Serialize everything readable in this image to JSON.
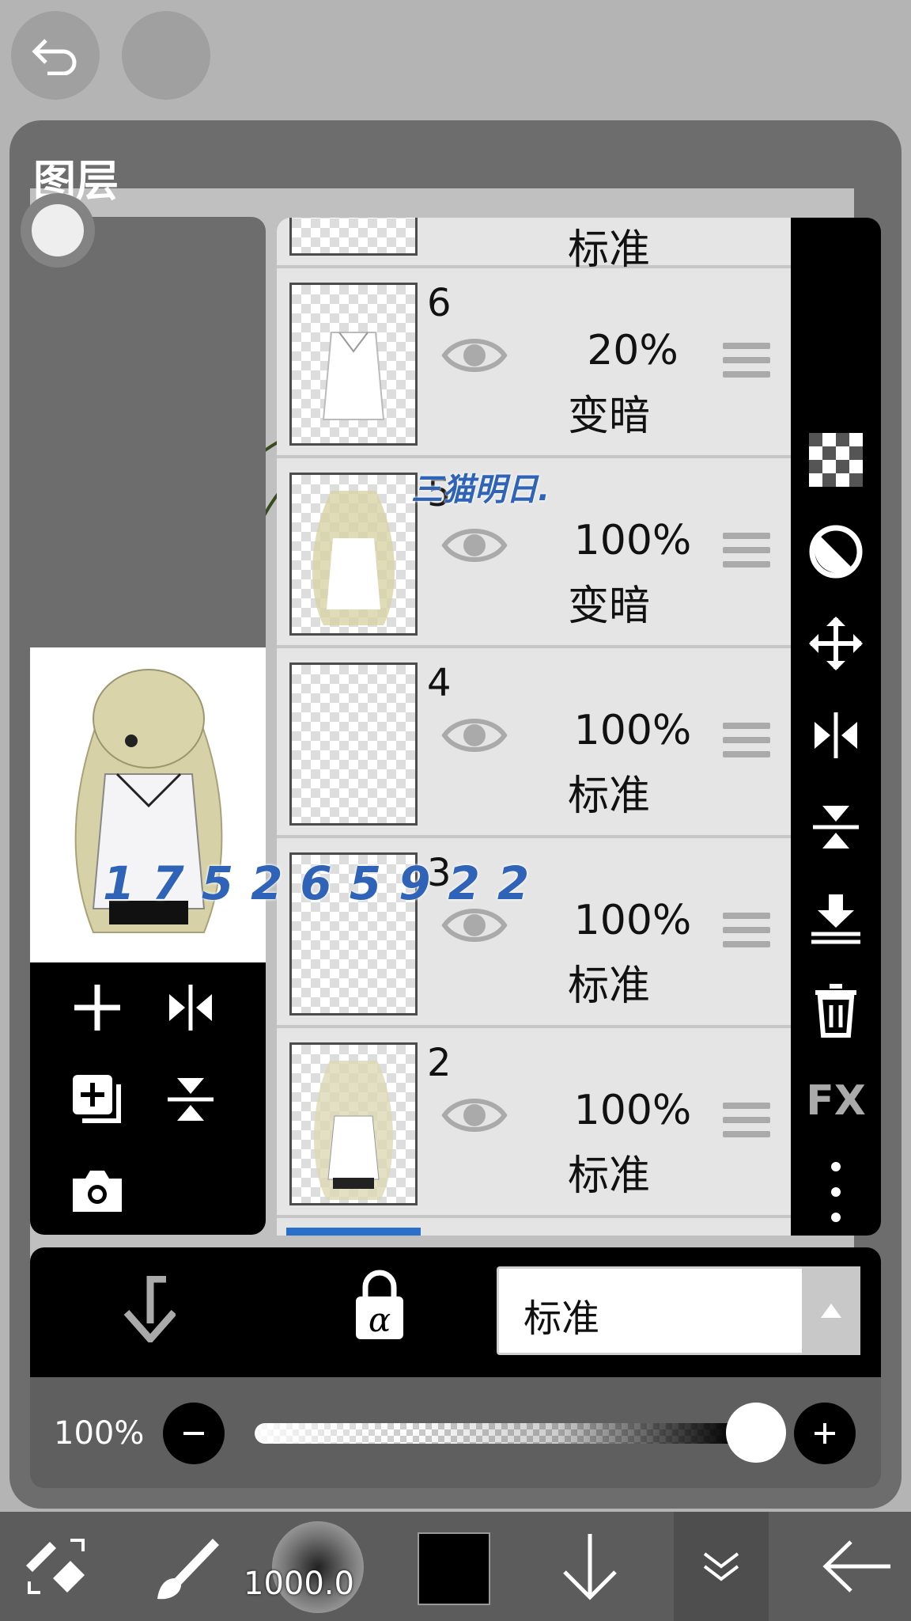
{
  "panel": {
    "title": "图层"
  },
  "layers": [
    {
      "number": "6",
      "opacity": "20%",
      "mode": "变暗"
    },
    {
      "number": "5",
      "opacity": "100%",
      "mode": "变暗"
    },
    {
      "number": "4",
      "opacity": "100%",
      "mode": "标准"
    },
    {
      "number": "3",
      "opacity": "100%",
      "mode": "标准"
    },
    {
      "number": "2",
      "opacity": "100%",
      "mode": "标准"
    }
  ],
  "top_layer_partial": {
    "mode": "标准"
  },
  "blend_mode": {
    "selected": "标准"
  },
  "layer_opacity": {
    "label": "100%",
    "value": 100
  },
  "brush": {
    "size": "1000.0"
  },
  "colors": {
    "primary": "#000000",
    "panel": "#6d6d6d",
    "accent": "#2a6fc9"
  },
  "right_tools": [
    "transparency-icon",
    "clipping-icon",
    "move-icon",
    "flip-horizontal-icon",
    "flip-vertical-icon",
    "merge-down-icon",
    "delete-icon",
    "fx-label",
    "more-icon"
  ],
  "fx_label": "FX",
  "watermarks": {
    "top": "三猫明日.",
    "middle": "175265922"
  }
}
